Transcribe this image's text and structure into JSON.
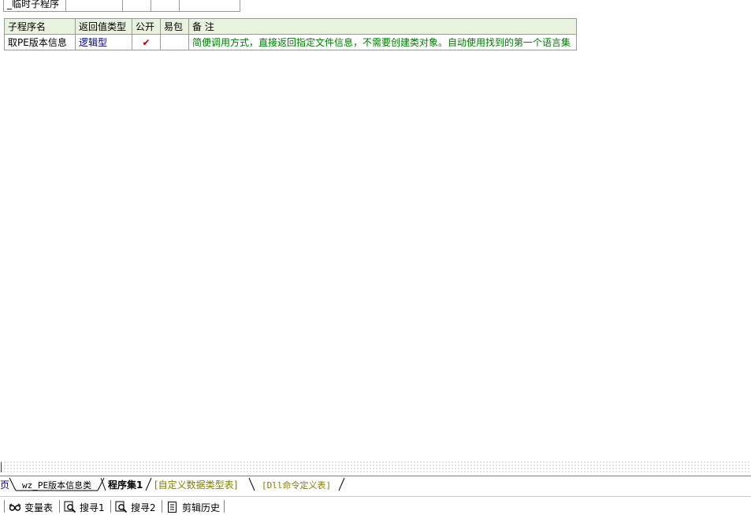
{
  "top_table": {
    "name": "_临时子程序"
  },
  "sub_table": {
    "headers": {
      "name": "子程序名",
      "return_type": "返回值类型",
      "public": "公开",
      "easy_pack": "易包",
      "remark": "备 注"
    },
    "row": {
      "name": "取PE版本信息",
      "return_type": "逻辑型",
      "public": "✔",
      "remark": "简便调用方式，直接返回指定文件信息，不需要创建类对象。自动使用找到的第一个语言集"
    }
  },
  "tabs": {
    "home": "页",
    "class": "wz_PE版本信息类",
    "progset": "程序集1",
    "customtype": "[自定义数据类型表]",
    "dll": "[Dll命令定义表]"
  },
  "statusbar": {
    "vars": "变量表",
    "search1": "搜寻1",
    "search2": "搜寻2",
    "clip": "剪辑历史"
  }
}
